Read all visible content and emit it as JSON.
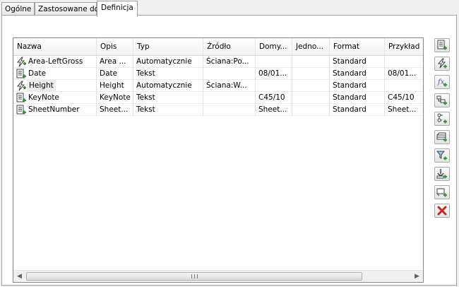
{
  "tabs": [
    {
      "label": "Ogólne",
      "active": false
    },
    {
      "label": "Zastosowane do",
      "active": false
    },
    {
      "label": "Definicja",
      "active": true
    }
  ],
  "table": {
    "columns": [
      "Nazwa",
      "Opis",
      "Typ",
      "Źródło",
      "Domy...",
      "Jedno...",
      "Format",
      "Przykład"
    ],
    "rows": [
      {
        "icon": "formula-icon",
        "cells": [
          "Area-LeftGross",
          "Area ...",
          "Automatycznie",
          "Ściana:Po...",
          "",
          "",
          "Standard",
          ""
        ]
      },
      {
        "icon": "text-property-icon",
        "cells": [
          "Date",
          "Date",
          "Tekst",
          "",
          "08/01...",
          "",
          "Standard",
          "08/01..."
        ]
      },
      {
        "icon": "formula-icon",
        "cells": [
          "Height",
          "Height",
          "Automatycznie",
          "Ściana:W...",
          "",
          "",
          "Standard",
          ""
        ]
      },
      {
        "icon": "text-property-icon",
        "cells": [
          "KeyNote",
          "KeyNote",
          "Tekst",
          "",
          "C45/10",
          "",
          "Standard",
          "C45/10"
        ]
      },
      {
        "icon": "text-property-icon",
        "cells": [
          "SheetNumber",
          "Sheet...",
          "Tekst",
          "",
          "Sheet...",
          "",
          "Standard",
          "Sheet..."
        ]
      }
    ]
  },
  "scrollbar": {
    "grip_symbol": "III"
  },
  "toolbar": [
    {
      "icon": "add-text-property-icon"
    },
    {
      "icon": "add-automatic-property-icon"
    },
    {
      "icon": "add-formula-property-icon"
    },
    {
      "icon": "add-list-property-icon"
    },
    {
      "icon": "add-selection-property-icon"
    },
    {
      "icon": "add-table-property-icon"
    },
    {
      "icon": "add-filter-property-icon"
    },
    {
      "icon": "add-reference-property-icon"
    },
    {
      "icon": "add-location-property-icon"
    },
    {
      "icon": "delete-icon"
    }
  ],
  "colors": {
    "green_plus": "#2e9b2e",
    "delete_red": "#d42020",
    "formula_purple": "#6a4fb0"
  }
}
